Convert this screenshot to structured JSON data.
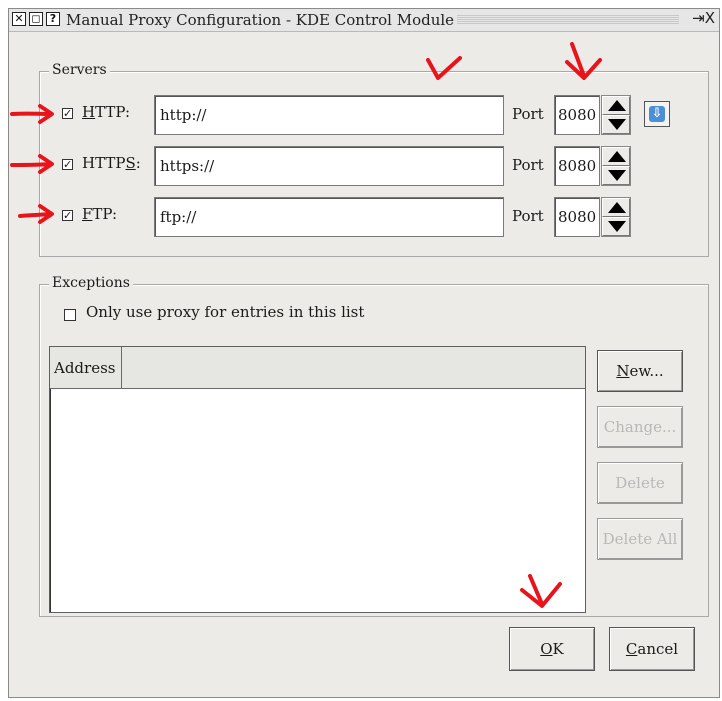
{
  "window": {
    "title": "Manual Proxy Configuration - KDE Control Module",
    "titlebar_buttons": [
      "✕",
      "◻",
      "?"
    ],
    "titlebar_right": "⇥X"
  },
  "servers": {
    "group_title": "Servers",
    "rows": [
      {
        "label_pre": "",
        "label_mnemonic": "H",
        "label_post": "TTP:",
        "checked": true,
        "url": "http://",
        "port_label": "Port",
        "port": "8080"
      },
      {
        "label_pre": "HTTP",
        "label_mnemonic": "S",
        "label_post": ":",
        "checked": true,
        "url": "https://",
        "port_label": "Port",
        "port": "8080"
      },
      {
        "label_pre": "",
        "label_mnemonic": "F",
        "label_post": "TP:",
        "checked": true,
        "url": "ftp://",
        "port_label": "Port",
        "port": "8080"
      }
    ],
    "copy_down_icon": "arrow-down-icon"
  },
  "exceptions": {
    "group_title": "Exceptions",
    "only_use_label": "Only use proxy for entries in this list",
    "only_use_checked": false,
    "list_column": "Address",
    "buttons": {
      "new": {
        "mnemonic": "N",
        "rest": "ew..."
      },
      "change": "Change...",
      "delete": "Delete",
      "delete_all": "Delete All"
    }
  },
  "footer": {
    "ok": {
      "mnemonic": "O",
      "rest": "K"
    },
    "cancel": {
      "mnemonic": "C",
      "rest": "ancel"
    }
  },
  "annotations": {
    "color": "#e8141b",
    "count": 6
  }
}
